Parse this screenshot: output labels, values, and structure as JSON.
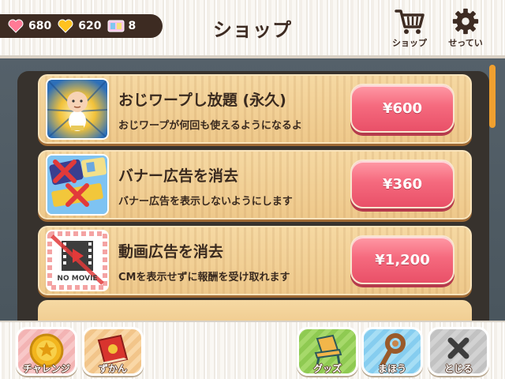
{
  "header": {
    "title": "ショップ",
    "stats": {
      "hearts": "680",
      "gold_hearts": "620",
      "tickets": "8"
    },
    "shop_button_label": "ショップ",
    "settings_button_label": "せってい"
  },
  "items": [
    {
      "name": "おじワープし放題 (永久)",
      "description": "おじワープが何回も使えるようになるよ",
      "price": "¥600",
      "thumb_icon": "warping-old-man-icon"
    },
    {
      "name": "バナー広告を消去",
      "description": "バナー広告を表示しないようにします",
      "price": "¥360",
      "thumb_icon": "no-banner-ads-icon"
    },
    {
      "name": "動画広告を消去",
      "description": "CMを表示せずに報酬を受け取れます",
      "price": "¥1,200",
      "thumb_icon": "no-movie-icon",
      "thumb_text": "NO MOVIE"
    }
  ],
  "footer": {
    "challenge_label": "チャレンジ",
    "encyclopedia_label": "ずかん",
    "goods_label": "グッズ",
    "magic_label": "まほう",
    "close_label": "とじる"
  },
  "colors": {
    "price_button": "#f56a7e",
    "wood_row": "#eec88a",
    "dark_text": "#3a2a1f",
    "scrollbar": "#f0a030"
  }
}
